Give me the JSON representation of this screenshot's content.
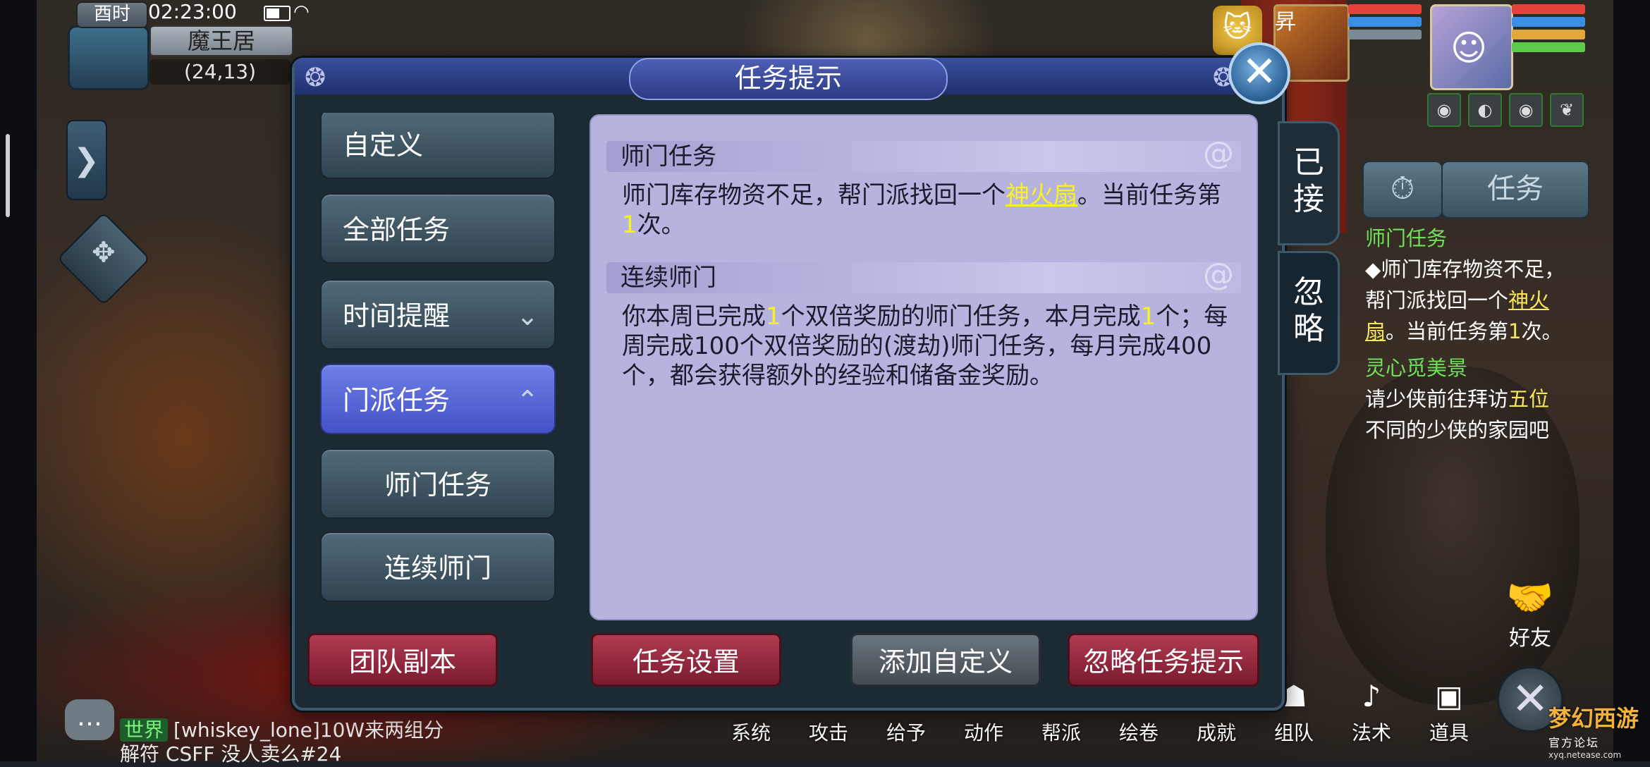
{
  "status": {
    "clock_tag": "酉时",
    "time": "02:23:00",
    "location": "魔王居",
    "coords": "(24,13)"
  },
  "party": {
    "ally_tag": "昇",
    "hp_color": "#e4433a",
    "mp_color": "#3a8ee4",
    "sp_color": "#e4a83a",
    "exp_color": "#5ccb4a"
  },
  "dialog": {
    "title": "任务提示",
    "categories": [
      {
        "label": "自定义"
      },
      {
        "label": "全部任务"
      },
      {
        "label": "时间提醒"
      },
      {
        "label": "门派任务"
      },
      {
        "label": "师门任务"
      },
      {
        "label": "连续师门"
      }
    ],
    "sections": [
      {
        "title": "师门任务",
        "text_pre": "师门库存物资不足，帮门派找回一个",
        "item": "神火扇",
        "text_mid": "。当前任务第",
        "count": "1",
        "text_post": "次。"
      },
      {
        "title": "连续师门",
        "p1": "你本周已完成",
        "n1": "1",
        "p2": "个双倍奖励的师门任务，本月完成",
        "n2": "1",
        "p3": "个；每周完成100个双倍奖励的(渡劫)师门任务，每月完成400个，都会获得额外的经验和储备金奖励。"
      }
    ],
    "side_tabs": {
      "accepted": "已接",
      "ignore": "忽略"
    },
    "buttons": {
      "team_dungeon": "团队副本",
      "task_settings": "任务设置",
      "add_custom": "添加自定义",
      "ignore_hint": "忽略任务提示"
    }
  },
  "tracker": {
    "task_button": "任务",
    "task1_title": "师门任务",
    "task1_pre": "◆师门库存物资不足，帮门派找回一个",
    "task1_item": "神火扇",
    "task1_mid": "。当前任务第",
    "task1_count": "1",
    "task1_post": "次。",
    "task2_title": "灵心觅美景",
    "task2_pre": "请少侠前往拜访",
    "task2_highlight": "五位",
    "task2_post": "不同的少侠的家园吧"
  },
  "dock": [
    "系统",
    "攻击",
    "给予",
    "动作",
    "帮派",
    "绘卷",
    "成就",
    "组队",
    "法术",
    "道具"
  ],
  "friend_label": "好友",
  "chat": {
    "channel": "世界",
    "line1": "[whiskey_lone]10W来两组分",
    "line2": "解符 CSFF 没人卖么#24"
  },
  "logo": {
    "name": "梦幻西游",
    "sub": "官方论坛",
    "url": "xyq.netease.com"
  }
}
